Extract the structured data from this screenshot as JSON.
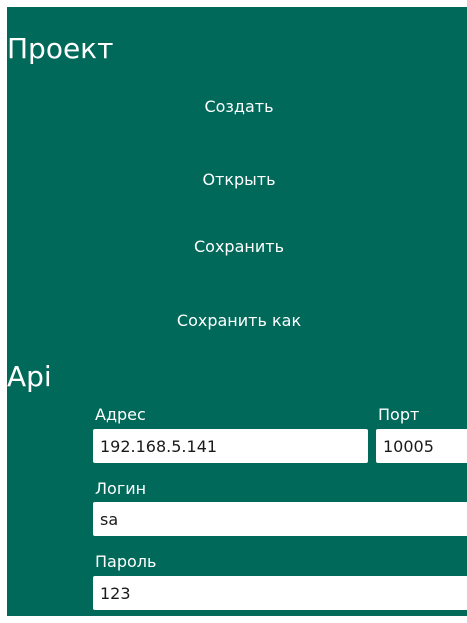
{
  "project": {
    "title": "Проект",
    "buttons": {
      "create": "Создать",
      "open": "Открыть",
      "save": "Сохранить",
      "save_as": "Сохранить как"
    }
  },
  "api": {
    "title": "Api",
    "address": {
      "label": "Адрес",
      "value": "192.168.5.141"
    },
    "port": {
      "label": "Порт",
      "value": "10005"
    },
    "login": {
      "label": "Логин",
      "value": "sa"
    },
    "password": {
      "label": "Пароль",
      "value": "123"
    }
  },
  "colors": {
    "panel_background": "#00695a",
    "text": "#ffffff",
    "input_background": "#ffffff"
  }
}
